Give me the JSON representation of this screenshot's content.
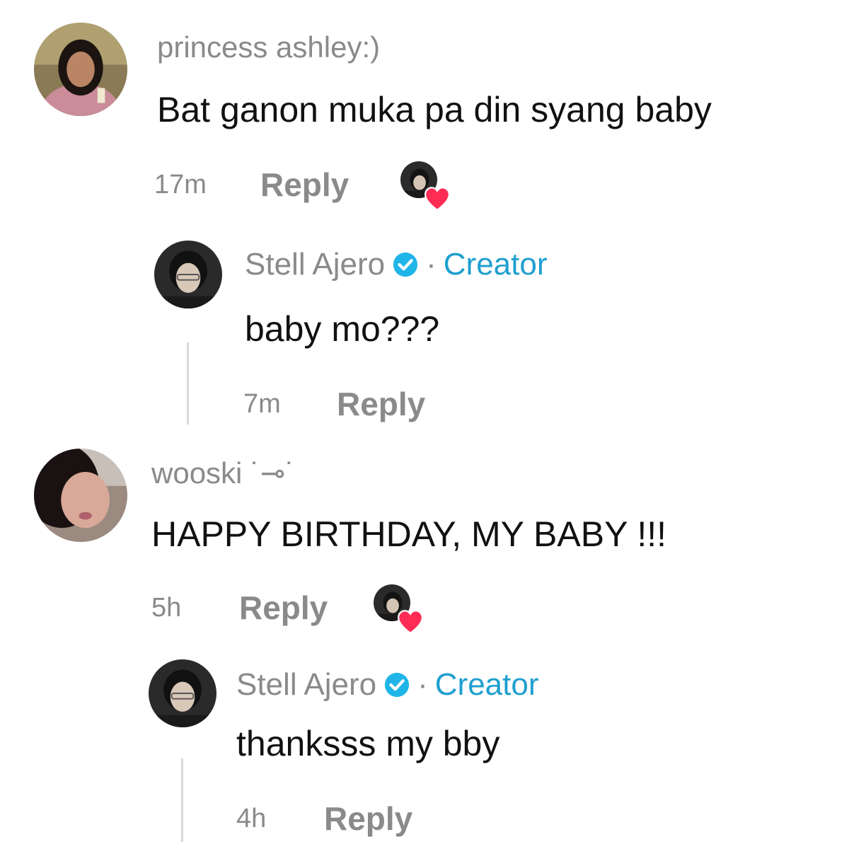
{
  "comments": [
    {
      "username": "princess ashley:)",
      "text": "Bat ganon muka pa din syang baby",
      "time": "17m",
      "reply_label": "Reply",
      "liked_by_creator": true,
      "reply": {
        "name": "Stell Ajero",
        "separator": "·",
        "badge": "Creator",
        "text": "baby mo???",
        "time": "7m",
        "reply_label": "Reply"
      }
    },
    {
      "username": "wooski ˙⊸˙",
      "text": "HAPPY BIRTHDAY, MY BABY !!!",
      "time": "5h",
      "reply_label": "Reply",
      "liked_by_creator": true,
      "reply": {
        "name": "Stell Ajero",
        "separator": "·",
        "badge": "Creator",
        "text": "thanksss my bby",
        "time": "4h",
        "reply_label": "Reply"
      }
    }
  ],
  "colors": {
    "muted": "#8a8a8a",
    "creator_accent": "#1f9fcf",
    "heart": "#fe2c55",
    "text": "#111111"
  },
  "icons": [
    "verified-badge-icon",
    "heart-icon"
  ]
}
